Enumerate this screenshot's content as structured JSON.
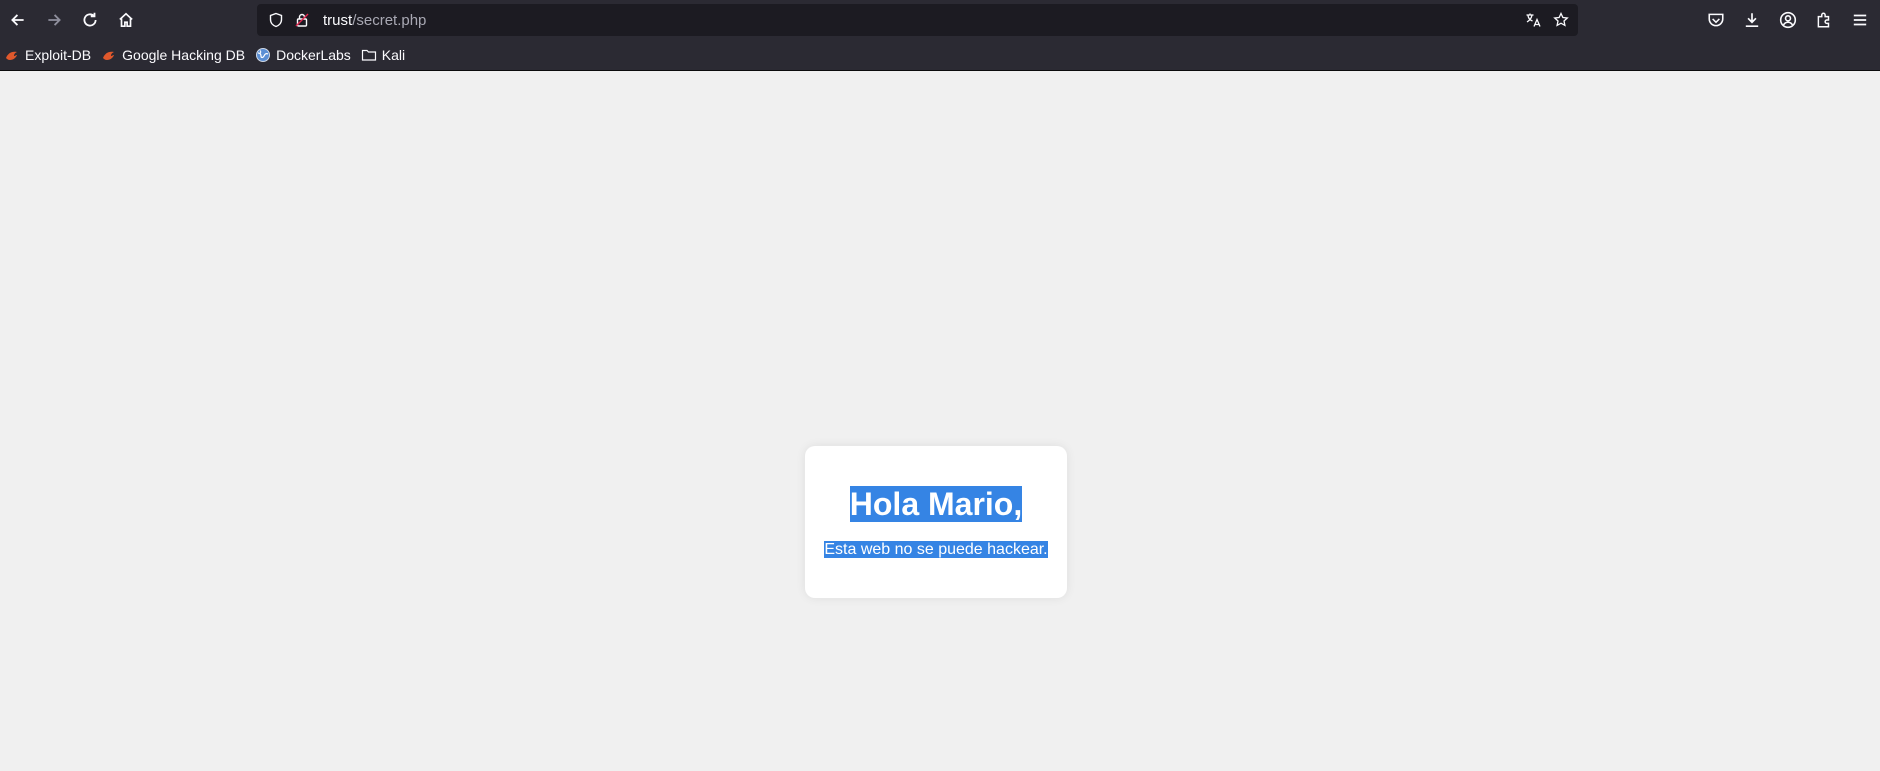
{
  "browser": {
    "url_host": "trust",
    "url_path": "/secret.php",
    "icons": {
      "back": "back-arrow-icon",
      "forward": "forward-arrow-icon",
      "reload": "reload-icon",
      "home": "home-icon",
      "tracking": "shield-icon",
      "lock": "lock-icon",
      "translate": "translate-icon",
      "bookmark_star": "star-icon",
      "pocket": "pocket-icon",
      "downloads": "download-icon",
      "account": "account-icon",
      "extensions": "extensions-icon",
      "menu": "hamburger-menu-icon"
    }
  },
  "bookmarks": [
    {
      "label": "Exploit-DB",
      "icon": "exploit-db-icon"
    },
    {
      "label": "Google Hacking DB",
      "icon": "exploit-db-icon"
    },
    {
      "label": "DockerLabs",
      "icon": "dockerlabs-globe-icon"
    },
    {
      "label": "Kali",
      "icon": "folder-icon"
    }
  ],
  "page": {
    "heading": "Hola Mario,",
    "message": "Esta web no se puede hackear."
  },
  "colors": {
    "toolbar_bg": "#2b2a33",
    "urlbar_bg": "#1c1b22",
    "page_bg": "#f0f0f0",
    "selection_highlight": "#3584e4"
  }
}
